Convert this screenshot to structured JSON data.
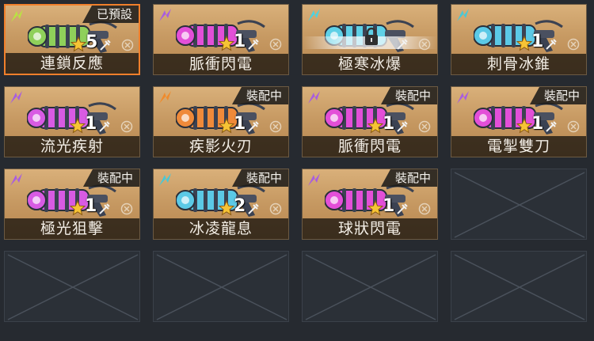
{
  "cards": [
    {
      "name": "連鎖反應",
      "level": "5",
      "badge": "已預設",
      "color": "#8fd05a",
      "elem": "#b9e341",
      "icon": "chain-lightning-icon",
      "selected": true,
      "locked": false
    },
    {
      "name": "脈衝閃電",
      "level": "1",
      "badge": "",
      "color": "#e34fd8",
      "elem": "#a85de0",
      "icon": "pulse-lightning-icon",
      "selected": false,
      "locked": false
    },
    {
      "name": "極寒冰爆",
      "level": "",
      "badge": "",
      "color": "#5fd0e6",
      "elem": "#4ad3e3",
      "icon": "frost-burst-icon",
      "selected": false,
      "locked": true
    },
    {
      "name": "刺骨冰錐",
      "level": "1",
      "badge": "",
      "color": "#5bc9e6",
      "elem": "#46c8d8",
      "icon": "ice-spike-icon",
      "selected": false,
      "locked": false
    },
    {
      "name": "流光疾射",
      "level": "1",
      "badge": "",
      "color": "#d85be3",
      "elem": "#a85de0",
      "icon": "light-stream-icon",
      "selected": false,
      "locked": false
    },
    {
      "name": "疾影火刃",
      "level": "1",
      "badge": "裝配中",
      "color": "#ef8a3a",
      "elem": "#f08a2b",
      "icon": "fire-blade-icon",
      "selected": false,
      "locked": false
    },
    {
      "name": "脈衝閃電",
      "level": "1",
      "badge": "裝配中",
      "color": "#e34fd8",
      "elem": "#a85de0",
      "icon": "pulse-lightning-icon",
      "selected": false,
      "locked": false
    },
    {
      "name": "電掣雙刀",
      "level": "1",
      "badge": "裝配中",
      "color": "#e34fd8",
      "elem": "#a85de0",
      "icon": "twin-blades-icon",
      "selected": false,
      "locked": false
    },
    {
      "name": "極光狙擊",
      "level": "1",
      "badge": "裝配中",
      "color": "#d85be3",
      "elem": "#a85de0",
      "icon": "aurora-snipe-icon",
      "selected": false,
      "locked": false
    },
    {
      "name": "冰凌龍息",
      "level": "2",
      "badge": "裝配中",
      "color": "#5bc9e6",
      "elem": "#46c8d8",
      "icon": "ice-dragon-icon",
      "selected": false,
      "locked": false
    },
    {
      "name": "球狀閃電",
      "level": "1",
      "badge": "裝配中",
      "color": "#e34fd8",
      "elem": "#a85de0",
      "icon": "ball-lightning-icon",
      "selected": false,
      "locked": false
    }
  ],
  "empty_slots": 5
}
